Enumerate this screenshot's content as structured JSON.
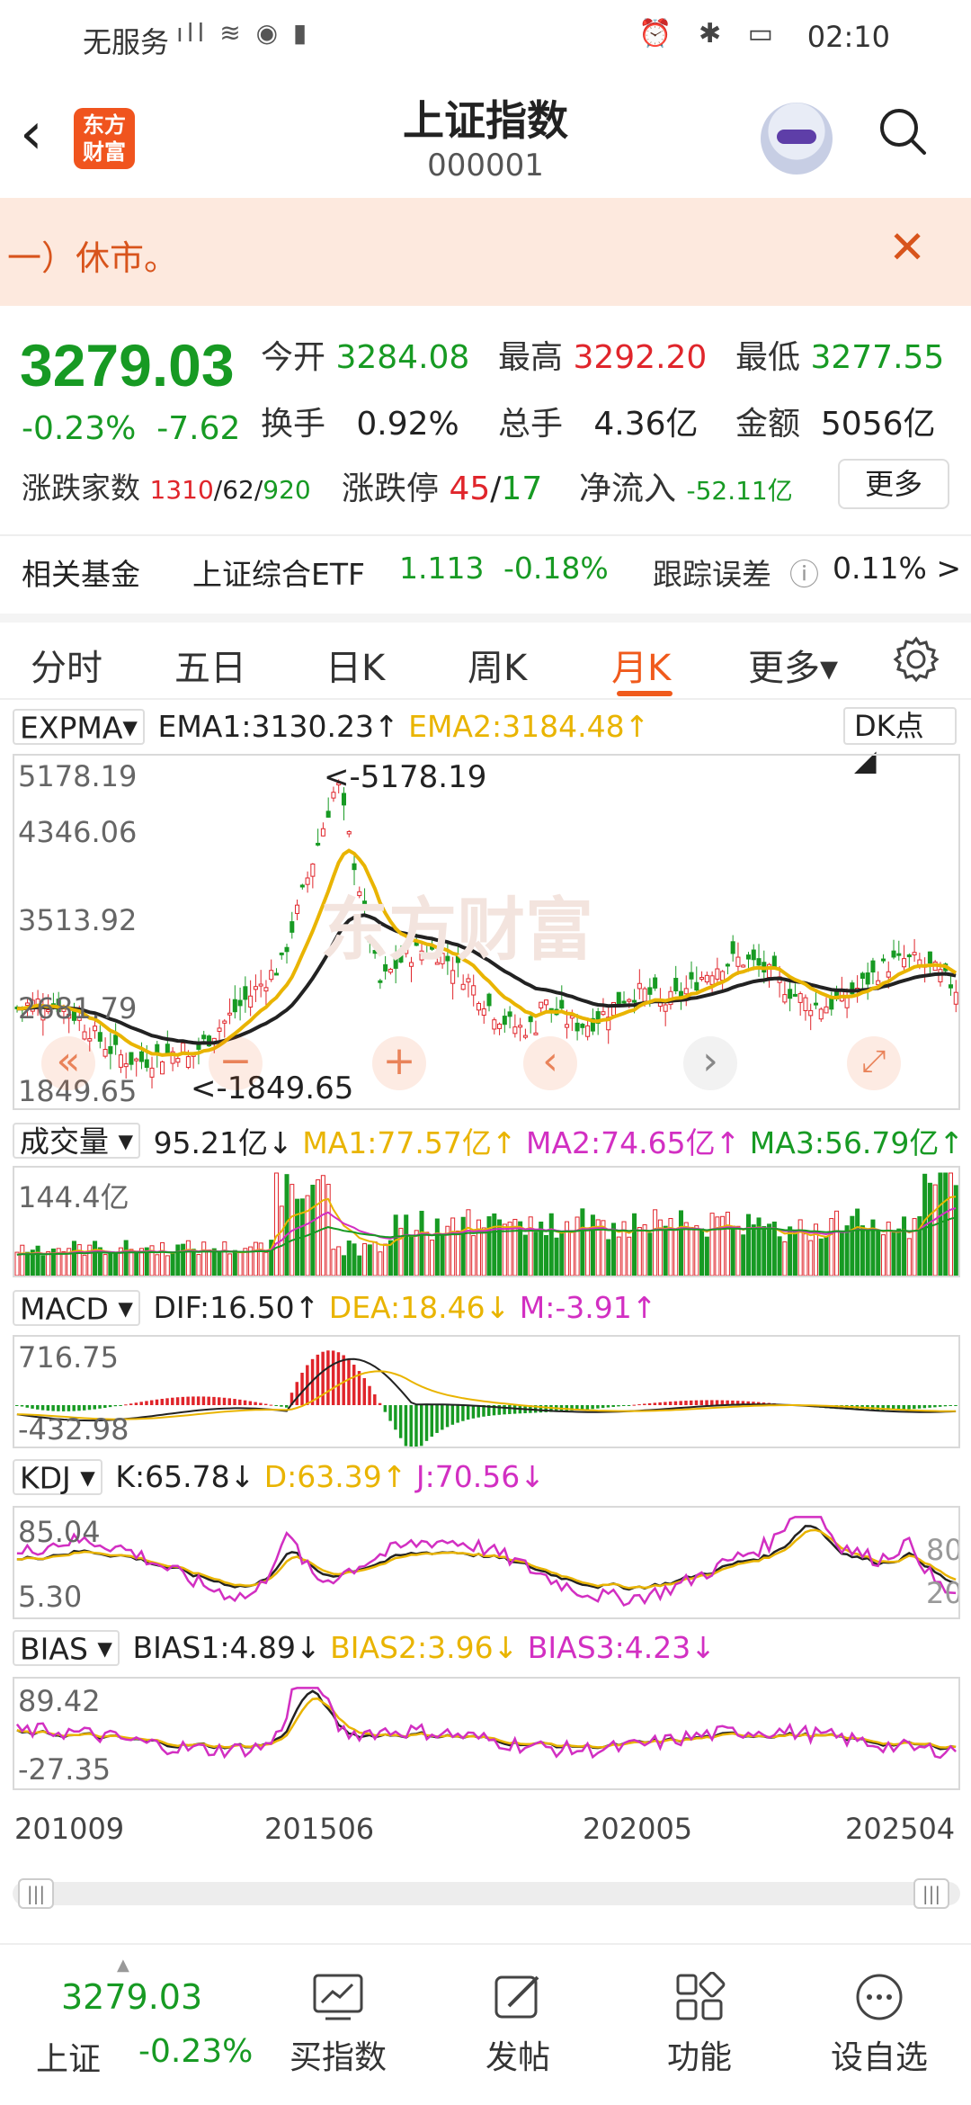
{
  "status": {
    "carrier": "无服务",
    "time": "02:10"
  },
  "header": {
    "logo_text": "东方财富",
    "title": "上证指数",
    "code": "000001"
  },
  "banner": {
    "text": "一）休市。"
  },
  "quote": {
    "price": "3279.03",
    "change_pct": "-0.23%",
    "change": "-7.62",
    "open_label": "今开",
    "open": "3284.08",
    "high_label": "最高",
    "high": "3292.20",
    "low_label": "最低",
    "low": "3277.55",
    "turnover_label": "换手",
    "turnover": "0.92%",
    "volume_label": "总手",
    "volume": "4.36亿",
    "amount_label": "金额",
    "amount": "5056亿",
    "breadth_label": "涨跌家数",
    "breadth_up": "1310",
    "breadth_flat": "62",
    "breadth_down": "920",
    "limit_label": "涨跌停",
    "limit_up": "45",
    "limit_down": "17",
    "inflow_label": "净流入",
    "inflow": "-52.11亿",
    "more_label": "更多"
  },
  "fund": {
    "label": "相关基金",
    "name": "上证综合ETF",
    "price": "1.113",
    "change": "-0.18%",
    "error_label": "跟踪误差",
    "error": "0.11% >"
  },
  "tabs": [
    "分时",
    "五日",
    "日K",
    "周K",
    "月K",
    "更多▾"
  ],
  "main_indicator": {
    "name": "EXPMA",
    "ema1": "EMA1:3130.23↑",
    "ema2": "EMA2:3184.48↑",
    "dk": "DK点"
  },
  "main_chart": {
    "y_ticks": [
      "5178.19",
      "4346.06",
      "3513.92",
      "2681.79",
      "1849.65"
    ],
    "max_label": "<-5178.19",
    "min_label": "<-1849.65"
  },
  "volume": {
    "name": "成交量",
    "value": "95.21亿↓",
    "ma1": "MA1:77.57亿↑",
    "ma2": "MA2:74.65亿↑",
    "ma3": "MA3:56.79亿↑",
    "y_tick": "144.4亿"
  },
  "macd": {
    "name": "MACD",
    "dif": "DIF:16.50↑",
    "dea": "DEA:18.46↓",
    "m": "M:-3.91↑",
    "y_top": "716.75",
    "y_bottom": "-432.98"
  },
  "kdj": {
    "name": "KDJ",
    "k": "K:65.78↓",
    "d": "D:63.39↑",
    "j": "J:70.56↓",
    "y_top": "85.04",
    "y_bottom": "5.30",
    "ref_high": "80",
    "ref_low": "20"
  },
  "bias": {
    "name": "BIAS",
    "b1": "BIAS1:4.89↓",
    "b2": "BIAS2:3.96↓",
    "b3": "BIAS3:4.23↓",
    "y_top": "89.42",
    "y_bottom": "-27.35"
  },
  "x_axis": [
    "201009",
    "201506",
    "202005",
    "202504"
  ],
  "colors": {
    "up": "#e0252b",
    "down": "#179a23",
    "ema1": "#222222",
    "ema2": "#e9b400",
    "ma3": "#d22fc2",
    "accent": "#f05a1c"
  },
  "bottom": {
    "price": "3279.03",
    "label": "上证",
    "change": "-0.23%",
    "items": [
      "买指数",
      "发帖",
      "功能",
      "设自选"
    ]
  }
}
